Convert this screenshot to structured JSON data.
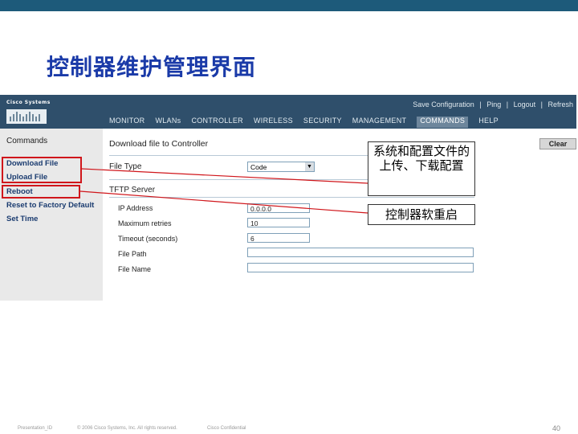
{
  "slide": {
    "title": "控制器维护管理界面"
  },
  "app": {
    "logo_text": "Cisco Systems",
    "header_links": [
      "Save Configuration",
      "|",
      "Ping",
      "|",
      "Logout",
      "|",
      "Refresh"
    ],
    "nav": [
      {
        "label": "MONITOR",
        "active": false
      },
      {
        "label": "WLANs",
        "active": false
      },
      {
        "label": "CONTROLLER",
        "active": false
      },
      {
        "label": "WIRELESS",
        "active": false
      },
      {
        "label": "SECURITY",
        "active": false
      },
      {
        "label": "MANAGEMENT",
        "active": false
      },
      {
        "label": "COMMANDS",
        "active": true
      },
      {
        "label": "HELP",
        "active": false
      }
    ],
    "sidebar": {
      "title": "Commands",
      "items": [
        "Download File",
        "Upload File",
        "Reboot",
        "Reset to Factory Default",
        "Set Time"
      ]
    },
    "main": {
      "title": "Download file to Controller",
      "file_type_label": "File Type",
      "file_type_value": "Code",
      "tftp_section": "TFTP Server",
      "fields": {
        "ip_label": "IP Address",
        "ip_value": "0.0.0.0",
        "retries_label": "Maximum retries",
        "retries_value": "10",
        "timeout_label": "Timeout (seconds)",
        "timeout_value": "6",
        "path_label": "File Path",
        "path_value": "",
        "name_label": "File Name",
        "name_value": ""
      },
      "clear_button": "Clear"
    }
  },
  "callouts": {
    "upload_download": "系统和配置文件的上传、下载配置",
    "reboot": "控制器软重启"
  },
  "footer": {
    "presentation": "Presentation_ID",
    "copyright": "© 2006 Cisco Systems, Inc. All rights reserved.",
    "confidential": "Cisco Confidential",
    "page": "40"
  },
  "colors": {
    "title": "#1a3aa8",
    "header": "#2f4f6b",
    "highlight": "#d0161b"
  }
}
